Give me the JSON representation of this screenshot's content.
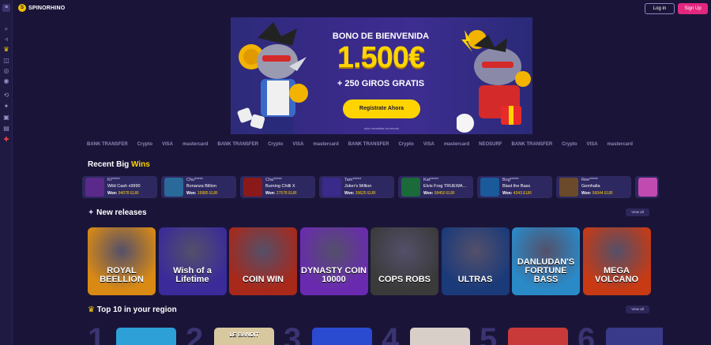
{
  "brand": {
    "name": "SPINORHINO"
  },
  "header": {
    "login_label": "Log in",
    "signup_label": "Sign Up"
  },
  "sidebar": {
    "icons": [
      "menu-icon",
      "search-icon",
      "megaphone-icon",
      "crown-icon",
      "gamepad-icon",
      "casino-chip-icon",
      "live-icon",
      "history-icon",
      "gift-icon",
      "support-icon",
      "promo-icon",
      "chat-icon",
      "flag-uk-icon"
    ]
  },
  "banner": {
    "title": "BONO DE BIENVENIDA",
    "amount": "1.500€",
    "subtitle": "+ 250 GIROS GRATIS",
    "cta": "Regístrate Ahora",
    "note": "solo necesitas un minuto"
  },
  "payments": [
    "BANK TRANSFER",
    "Crypto",
    "VISA",
    "mastercard",
    "BANK TRANSFER",
    "Crypto",
    "VISA",
    "mastercard",
    "BANK TRANSFER",
    "Crypto",
    "VISA",
    "mastercard",
    "NEOSURF",
    "BANK TRANSFER",
    "Crypto",
    "VISA",
    "mastercard"
  ],
  "recent_wins": {
    "title": "Recent Big",
    "title_accent": "Wins",
    "won_label": "Won:",
    "items": [
      {
        "user": "Ki*****",
        "game": "Wild Cash x9990",
        "amount": "94078 EUR",
        "color": "#5a2a8a"
      },
      {
        "user": "Chu*****",
        "game": "Bonanza Billion",
        "amount": "19985 EUR",
        "color": "#2a6a9a"
      },
      {
        "user": "Cha*****",
        "game": "Burning Chilli X",
        "amount": "27578 EUR",
        "color": "#8a1a1a"
      },
      {
        "user": "Tam*****",
        "game": "Joker's Million",
        "amount": "39625 EUR",
        "color": "#3a2a8a"
      },
      {
        "user": "Kat*****",
        "game": "Elvis Frog TRUEWA…",
        "amount": "99450 EUR",
        "color": "#1a6a3a"
      },
      {
        "user": "Bog*****",
        "game": "Blast the Bass",
        "amount": "4343 EUR",
        "color": "#1a5a9a"
      },
      {
        "user": "Ree*****",
        "game": "Gemhalla",
        "amount": "56044 EUR",
        "color": "#6a4a2a"
      }
    ]
  },
  "new_releases": {
    "title": "New releases",
    "view_all": "View all",
    "games": [
      {
        "name": "ROYAL BEELLION",
        "bg": "#d98a14"
      },
      {
        "name": "Wish of a Lifetime",
        "bg": "#3a2a9a"
      },
      {
        "name": "COIN WIN",
        "bg": "#a8281a"
      },
      {
        "name": "DYNASTY COIN 10000",
        "bg": "#6a2ab0"
      },
      {
        "name": "COPS ROBS",
        "bg": "#3a3a3a"
      },
      {
        "name": "ULTRAS",
        "bg": "#1a3a7a"
      },
      {
        "name": "DANLUDAN'S FORTUNE BASS",
        "bg": "#2a8ac8"
      },
      {
        "name": "MEGA VOLCANO",
        "bg": "#c83a14"
      }
    ]
  },
  "top10": {
    "title": "Top 10 in your region",
    "view_all": "View all",
    "items": [
      {
        "label": "",
        "bg": "#2ea0d8"
      },
      {
        "label": "LE BANDIT",
        "bg": "#d8c8a0"
      },
      {
        "label": "",
        "bg": "#2a4ad0"
      },
      {
        "label": "",
        "bg": "#d8d0c8"
      },
      {
        "label": "",
        "bg": "#c83a3a"
      },
      {
        "label": "",
        "bg": "#3a3a8a"
      }
    ]
  }
}
